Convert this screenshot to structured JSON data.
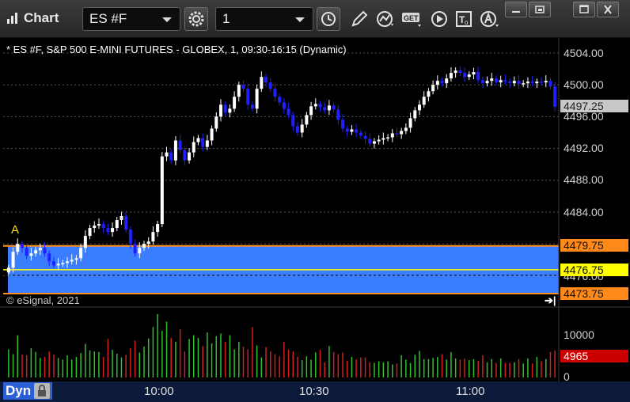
{
  "window": {
    "title": "Chart"
  },
  "toolbar": {
    "symbol_value": "ES #F",
    "interval_value": "1",
    "icons": [
      "symbol-settings-icon",
      "clock-icon",
      "pencil-draw-icon",
      "study-icon",
      "get-icon",
      "play-icon",
      "text-tool-icon",
      "alert-icon"
    ]
  },
  "window_buttons": [
    "minimize-icon",
    "restore-icon",
    "maximize-icon",
    "close-icon"
  ],
  "chart": {
    "caption": "* ES #F, S&P 500 E-MINI FUTURES - GLOBEX, 1, 09:30-16:15 (Dynamic)",
    "copyright": "© eSignal, 2021",
    "marker_label": "A",
    "price_axis": [
      "4504.00",
      "4500.00",
      "4496.00",
      "4492.00",
      "4488.00",
      "4484.00",
      "4476.00"
    ],
    "price_tags": {
      "last": "4497.25",
      "range_high": "4479.75",
      "mid": "4476.75",
      "range_low": "4473.75"
    },
    "volume_axis": [
      "10000",
      "0"
    ],
    "volume_tag": "4965",
    "time_axis": [
      "10:00",
      "10:30",
      "11:00"
    ],
    "dyn_label": "Dyn"
  },
  "colors": {
    "background": "#000000",
    "up_candle": "#ffffff",
    "down_candle": "#2020ff",
    "range_band": "#3a7dff",
    "range_line": "#ff9020",
    "mid_line": "#ffff00",
    "volume_up": "#30c030",
    "volume_down": "#d02020",
    "volume_tag": "#cc0000"
  },
  "chart_data": {
    "type": "candlestick",
    "title": "* ES #F, S&P 500 E-MINI FUTURES - GLOBEX, 1, 09:30-16:15 (Dynamic)",
    "x_ticks": [
      "10:00",
      "10:30",
      "11:00"
    ],
    "ylim": [
      4472,
      4506
    ],
    "y_ticks": [
      4476,
      4480,
      4484,
      4488,
      4492,
      4496,
      4500,
      4504
    ],
    "closes": [
      4477,
      4479,
      4480,
      4479.5,
      4478.5,
      4478.8,
      4479.2,
      4479.5,
      4478.8,
      4477.8,
      4477.3,
      4477.5,
      4477.6,
      4477.8,
      4478,
      4478.2,
      4479.5,
      4481,
      4482,
      4482.3,
      4482.5,
      4482,
      4481.5,
      4482,
      4483,
      4483.5,
      4481.8,
      4480,
      4478.8,
      4479.5,
      4480,
      4480.3,
      4481.5,
      4482.5,
      4491,
      4491.5,
      4490.5,
      4493,
      4491.8,
      4490.5,
      4491.5,
      4492.8,
      4493.3,
      4492.2,
      4493,
      4494.5,
      4496,
      4497.5,
      4496.5,
      4497,
      4498.5,
      4500,
      4499.5,
      4497.5,
      4497,
      4499.5,
      4501,
      4500.3,
      4499.5,
      4498.5,
      4497.8,
      4497,
      4496.2,
      4494.8,
      4494,
      4495,
      4496.2,
      4497.3,
      4497.6,
      4497.2,
      4496.8,
      4497.4,
      4496.9,
      4495.6,
      4494.5,
      4494.1,
      4494.4,
      4494,
      4493.6,
      4493.2,
      4492.6,
      4492.9,
      4493.1,
      4493.3,
      4493.4,
      4493.9,
      4493.8,
      4494.2,
      4494.6,
      4495.8,
      4496.8,
      4497.5,
      4498.5,
      4499.2,
      4500,
      4500.5,
      4500.2,
      4500.8,
      4501.5,
      4501.8,
      4501.5,
      4501,
      4501.3,
      4501.6,
      4500.6,
      4500.2,
      4500.5,
      4500.8,
      4500.3,
      4500.6,
      4500.4,
      4500.2,
      4500.5,
      4500.1,
      4500.2,
      4500.4,
      4500.2,
      4500.4,
      4500.3,
      4500.5,
      4499.8,
      4497.25
    ],
    "range_band": {
      "high": 4479.75,
      "low": 4473.75,
      "mid": 4476.75,
      "last": 4497.25
    },
    "volume_ylim": [
      0,
      13000
    ],
    "volume_ticks": [
      0,
      10000
    ],
    "volume": [
      5200,
      4300,
      7800,
      4200,
      4100,
      5400,
      4700,
      3600,
      3800,
      4800,
      4200,
      3600,
      3300,
      4100,
      3300,
      3800,
      4500,
      6200,
      5000,
      4800,
      4700,
      3800,
      7100,
      5100,
      4400,
      3700,
      4200,
      5400,
      6800,
      4600,
      5700,
      7200,
      9300,
      11700,
      8600,
      10300,
      7300,
      6600,
      8900,
      4800,
      7100,
      7800,
      7300,
      5800,
      8300,
      6300,
      7600,
      8100,
      6600,
      7800,
      5200,
      6600,
      5700,
      5200,
      9300,
      5900,
      3700,
      5600,
      4800,
      4300,
      3900,
      6600,
      5100,
      4800,
      3800,
      3200,
      3900,
      3300,
      4600,
      5100,
      2800,
      5800,
      4700,
      4300,
      4600,
      3100,
      3800,
      3300,
      3700,
      3700,
      2800,
      2700,
      3000,
      2800,
      3000,
      2400,
      2600,
      4100,
      3300,
      2700,
      4200,
      4900,
      3400,
      3400,
      3600,
      3800,
      4300,
      3300,
      4700,
      3500,
      3300,
      3500,
      3200,
      3400,
      3100,
      4100,
      2800,
      3400,
      2700,
      3500,
      2700,
      2700,
      2800,
      3400,
      2600,
      3500,
      2600,
      3800,
      3000,
      3400,
      4700,
      4965
    ],
    "volume_last": 4965
  }
}
